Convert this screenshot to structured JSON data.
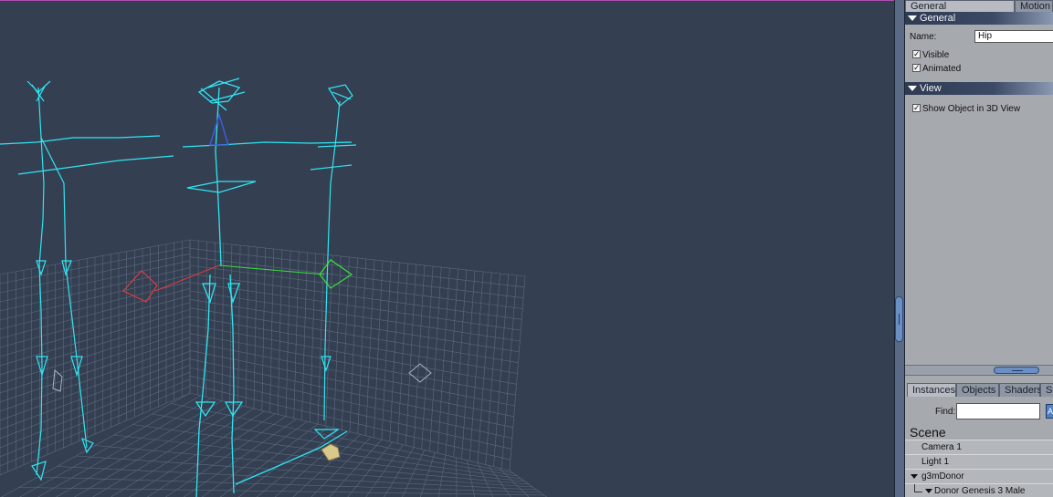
{
  "properties": {
    "tabs": [
      "General",
      "Motion"
    ],
    "sections": {
      "general": "General",
      "view": "View"
    },
    "name_label": "Name:",
    "name_value": "Hip",
    "checkboxes": {
      "visible": "Visible",
      "animated": "Animated",
      "show_in_3d": "Show Object in 3D View"
    }
  },
  "browser": {
    "tabs": [
      "Instances",
      "Objects",
      "Shaders",
      "Sc"
    ],
    "find_label": "Find:",
    "scene_title": "Scene",
    "items": [
      "Camera 1",
      "Light 1",
      "g3mDonor",
      "Donor Genesis 3 Male"
    ]
  },
  "colors": {
    "viewport_bg": "#343f52",
    "skeleton": "#2fe6f2",
    "grid": "#5d6a7d",
    "axis_x": "#e03b3b",
    "axis_y": "#3ee03e",
    "selected_bone": "#3a5fd6"
  }
}
